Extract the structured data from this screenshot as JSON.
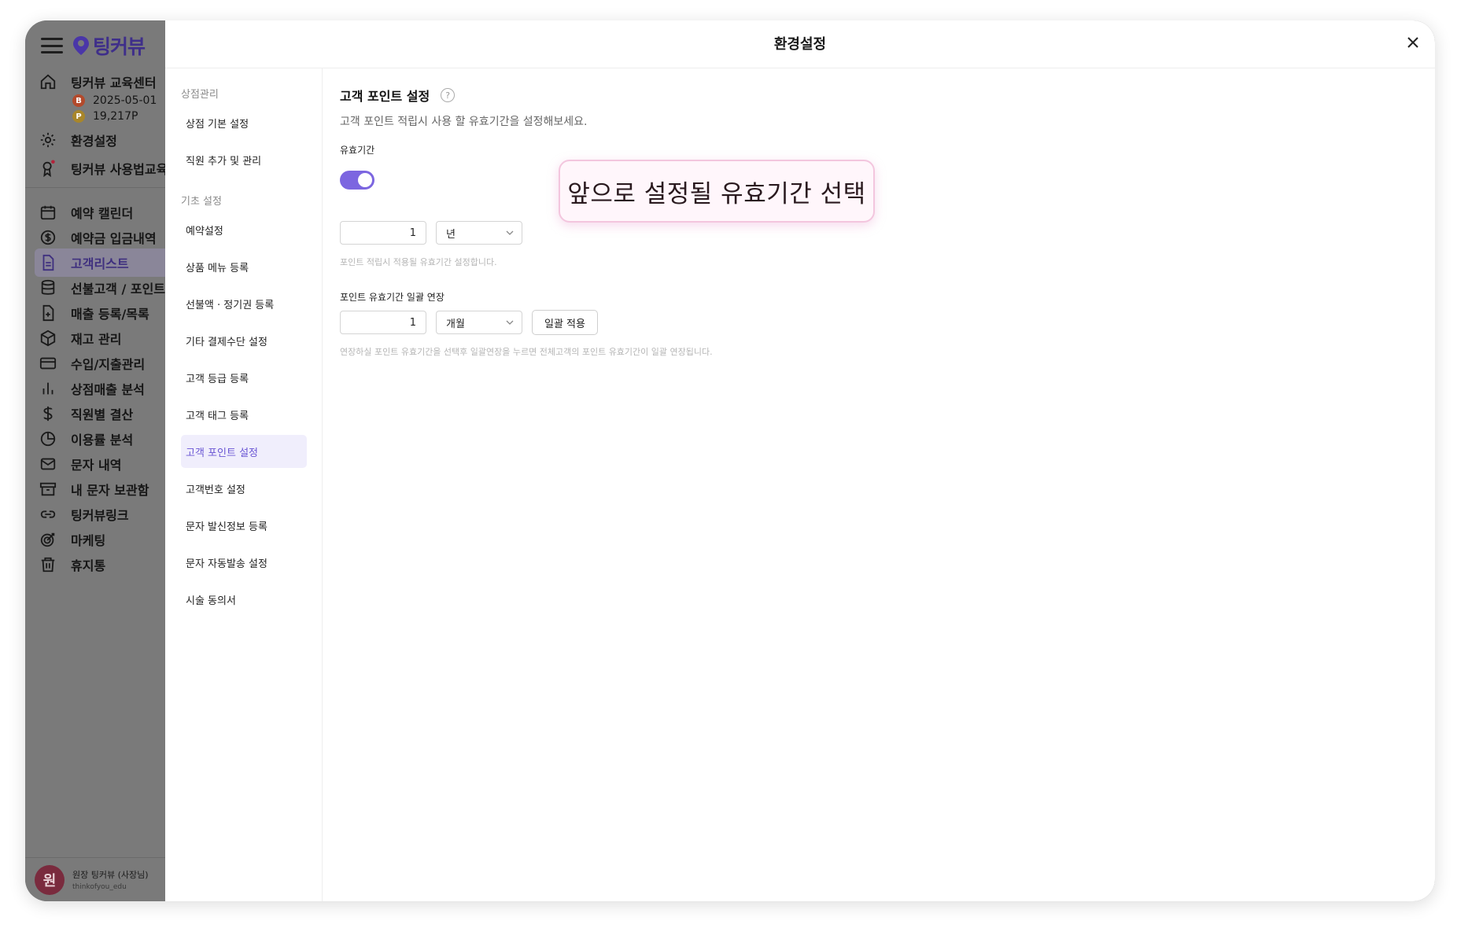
{
  "app": {
    "logo_text": "팅커뷰",
    "nav_top": [
      {
        "label": "팅커뷰 교육센터",
        "icon": "home-icon"
      },
      {
        "label": "환경설정",
        "icon": "gear-icon"
      },
      {
        "label": "팅커뷰 사용법교육",
        "icon": "award-icon"
      }
    ],
    "store_date": "2025-05-01",
    "store_points": "19,217P",
    "coin_b": "B",
    "coin_p": "P",
    "nav_main": [
      {
        "label": "예약 캘린더",
        "icon": "calendar-icon"
      },
      {
        "label": "예약금 입금내역",
        "icon": "dollar-circle-icon"
      },
      {
        "label": "고객리스트",
        "icon": "document-icon",
        "active": true
      },
      {
        "label": "선불고객 / 포인트고객",
        "icon": "database-icon"
      },
      {
        "label": "매출 등록/목록",
        "icon": "file-plus-icon"
      },
      {
        "label": "재고 관리",
        "icon": "box-icon"
      },
      {
        "label": "수입/지출관리",
        "icon": "credit-card-icon"
      },
      {
        "label": "상점매출 분석",
        "icon": "bar-chart-icon"
      },
      {
        "label": "직원별 결산",
        "icon": "dollar-icon"
      },
      {
        "label": "이용률 분석",
        "icon": "pie-chart-icon"
      },
      {
        "label": "문자 내역",
        "icon": "mail-icon"
      },
      {
        "label": "내 문자 보관함",
        "icon": "archive-icon"
      },
      {
        "label": "팅커뷰링크",
        "icon": "link-icon"
      },
      {
        "label": "마케팅",
        "icon": "target-icon"
      },
      {
        "label": "휴지통",
        "icon": "trash-icon"
      }
    ],
    "user": {
      "avatar": "원",
      "name": "원장 팅커뷰 (사장님)",
      "id": "thinkofyou_edu"
    }
  },
  "modal": {
    "title": "환경설정",
    "groups": [
      {
        "label": "상점관리",
        "items": [
          "상점 기본 설정",
          "직원 추가 및 관리"
        ]
      },
      {
        "label": "기초 설정",
        "items": [
          "예약설정",
          "상품 메뉴 등록",
          "선불액 · 정기권 등록",
          "기타 결제수단 설정",
          "고객 등급 등록",
          "고객 태그 등록",
          "고객 포인트 설정",
          "고객번호 설정",
          "문자 발신정보 등록",
          "문자 자동발송 설정",
          "시술 동의서"
        ]
      }
    ],
    "active_item": "고객 포인트 설정"
  },
  "content": {
    "title": "고객 포인트 설정",
    "help_symbol": "?",
    "description": "고객 포인트 적립시 사용 할 유효기간을 설정해보세요.",
    "validity": {
      "label": "유효기간",
      "toggle_on": true,
      "value": "1",
      "unit": "년",
      "hint": "포인트 적립시 적용될 유효기간 설정합니다."
    },
    "bulk": {
      "label": "포인트 유효기간 일괄 연장",
      "value": "1",
      "unit": "개월",
      "button": "일괄 적용",
      "hint": "연장하실 포인트 유효기간을 선택후 일괄연장을 누르면 전체고객의 포인트 유효기간이 일괄 연장됩니다."
    }
  },
  "callout": {
    "text": "앞으로 설정될 유효기간 선택"
  },
  "colors": {
    "accent": "#7c66e0",
    "active_bg": "#f0eefc",
    "callout_border": "#f3c6de"
  }
}
